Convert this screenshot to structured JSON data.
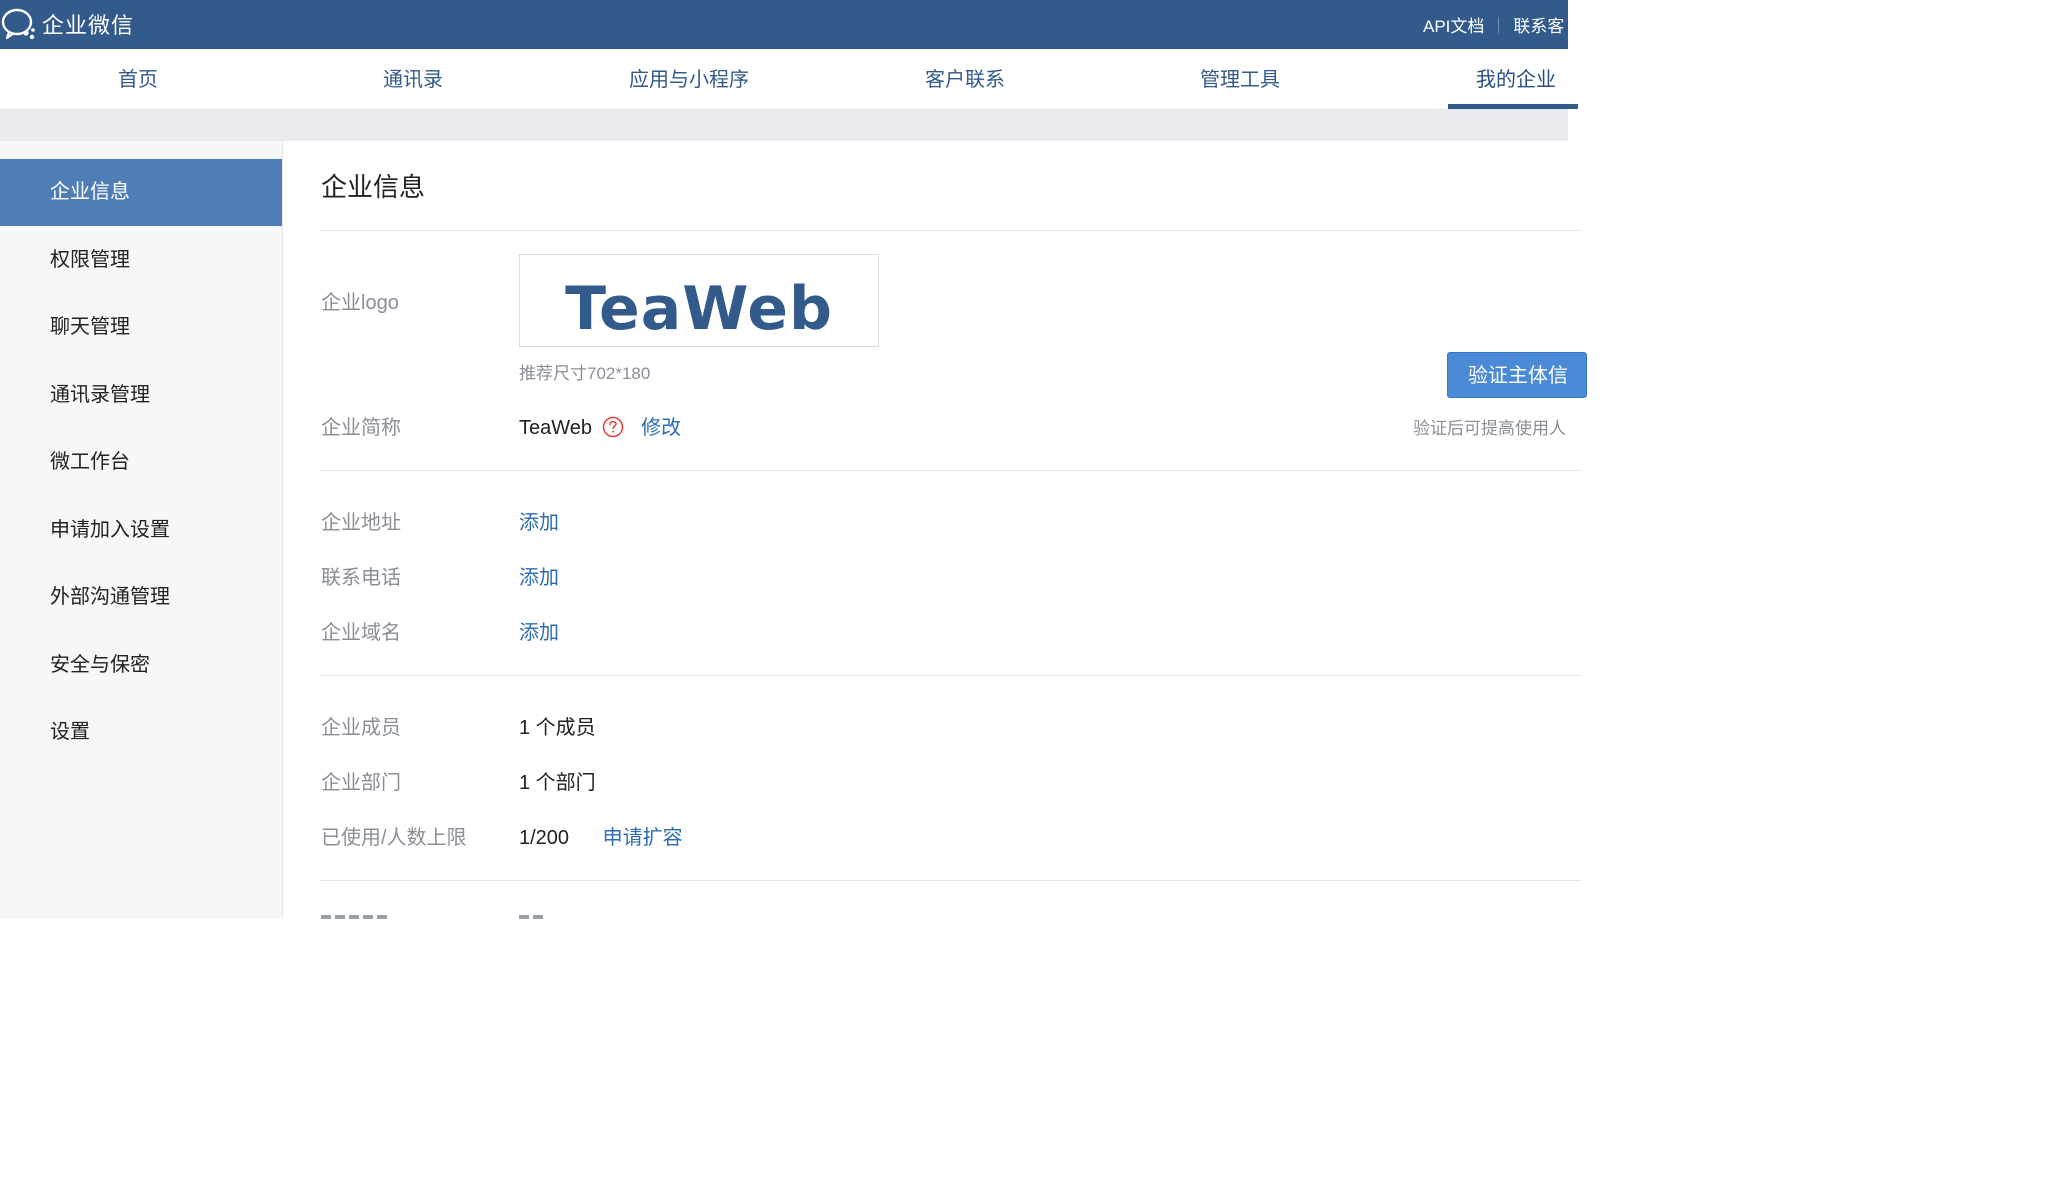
{
  "topbar": {
    "brand": "企业微信",
    "links": [
      "API文档",
      "联系客"
    ]
  },
  "nav": {
    "tabs": [
      "首页",
      "通讯录",
      "应用与小程序",
      "客户联系",
      "管理工具",
      "我的企业"
    ],
    "active": "我的企业"
  },
  "sidebar": {
    "items": [
      "企业信息",
      "权限管理",
      "聊天管理",
      "通讯录管理",
      "微工作台",
      "申请加入设置",
      "外部沟通管理",
      "安全与保密",
      "设置"
    ],
    "active": "企业信息"
  },
  "main": {
    "title": "企业信息",
    "logo": {
      "label": "企业logo",
      "text": "TeaWeb",
      "hint": "推荐尺寸702*180"
    },
    "short_name": {
      "label": "企业简称",
      "value": "TeaWeb",
      "help_icon": "question-circle-icon",
      "edit": "修改"
    },
    "verify": {
      "button": "验证主体信",
      "note": "验证后可提高使用人"
    },
    "address": {
      "label": "企业地址",
      "action": "添加"
    },
    "phone": {
      "label": "联系电话",
      "action": "添加"
    },
    "domain": {
      "label": "企业域名",
      "action": "添加"
    },
    "members": {
      "label": "企业成员",
      "value": "1 个成员"
    },
    "departments": {
      "label": "企业部门",
      "value": "1 个部门"
    },
    "limit": {
      "label": "已使用/人数上限",
      "value": "1/200",
      "action": "申请扩容"
    }
  },
  "colors": {
    "topbar": "#325a8a",
    "accent": "#4f7db6",
    "link": "#2a6cb5",
    "button": "#4a8ad6",
    "help_icon": "#e0433b"
  }
}
